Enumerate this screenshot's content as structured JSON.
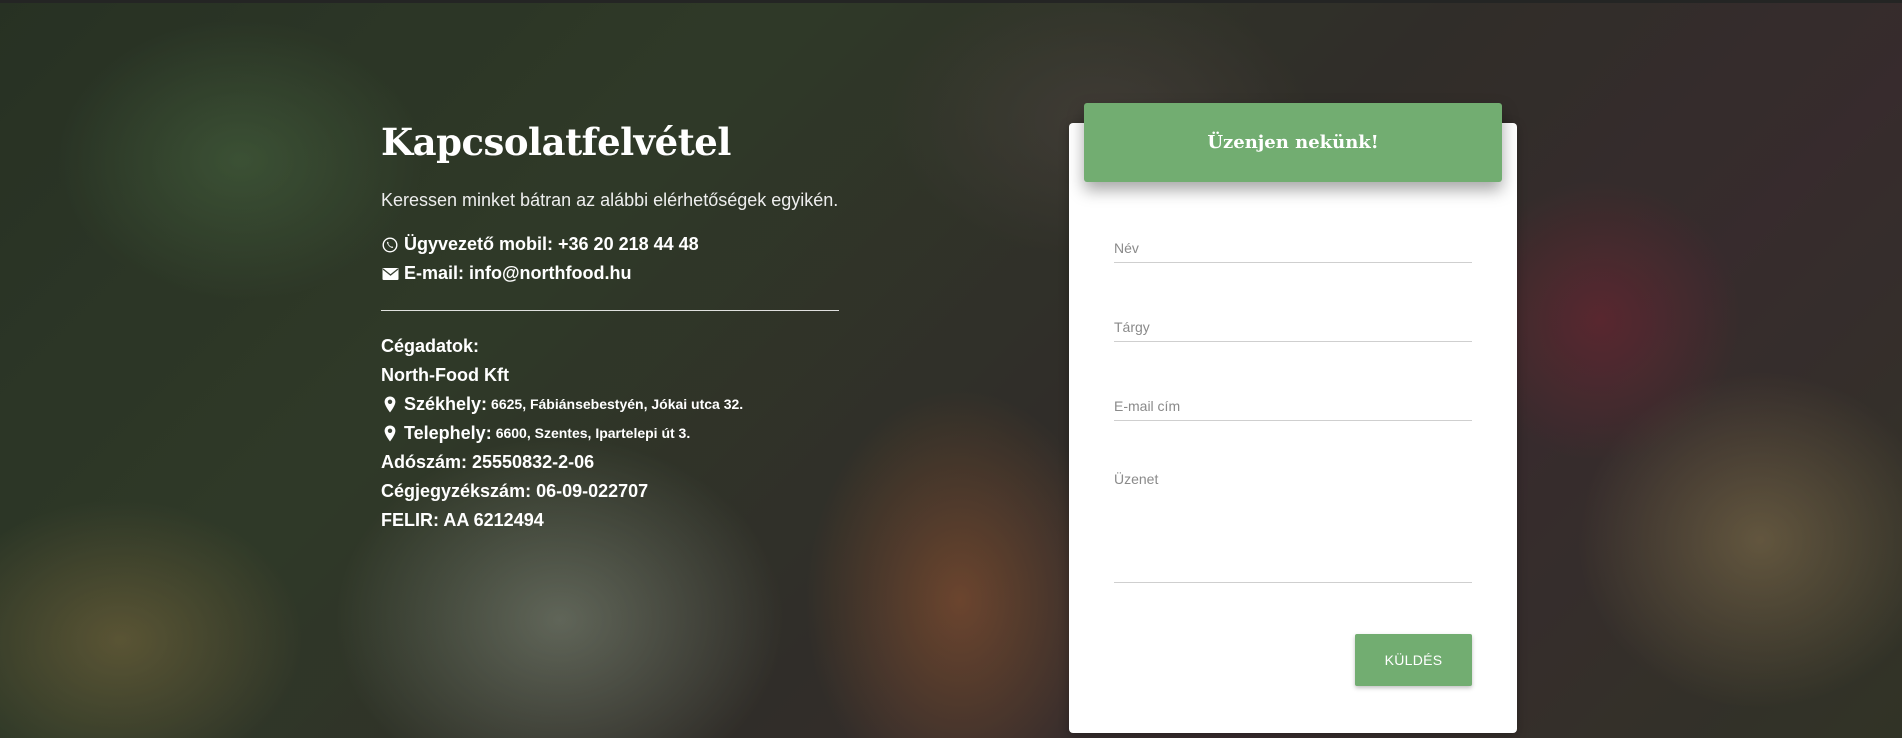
{
  "contact": {
    "title": "Kapcsolatfelvétel",
    "lead": "Keressen minket bátran az alábbi elérhetőségek egyikén.",
    "mobile": "Ügyvezető mobil: +36 20 218 44 48",
    "email": "E-mail: info@northfood.hu",
    "company": {
      "heading": "Cégadatok:",
      "name": "North-Food Kft",
      "hq_label": "Székhely:",
      "hq_address": "6625, Fábiánsebestyén, Jókai utca 32.",
      "site_label": "Telephely:",
      "site_address": "6600, Szentes, Ipartelepi út 3.",
      "tax_id": "Adószám: 25550832-2-06",
      "registration": "Cégjegyzékszám: 06-09-022707",
      "felir": "FELIR: AA 6212494"
    }
  },
  "form": {
    "header": "Üzenjen nekünk!",
    "name_placeholder": "Név",
    "subject_placeholder": "Tárgy",
    "email_placeholder": "E-mail cím",
    "message_placeholder": "Üzenet",
    "submit_label": "KÜLDÉS"
  },
  "colors": {
    "accent": "#72ad71",
    "card": "#ffffff",
    "text_light": "#ffffff"
  },
  "icons": {
    "mobile": "viber-phone-icon",
    "email": "envelope-icon",
    "hq": "map-marker-icon",
    "site": "map-marker-icon"
  }
}
